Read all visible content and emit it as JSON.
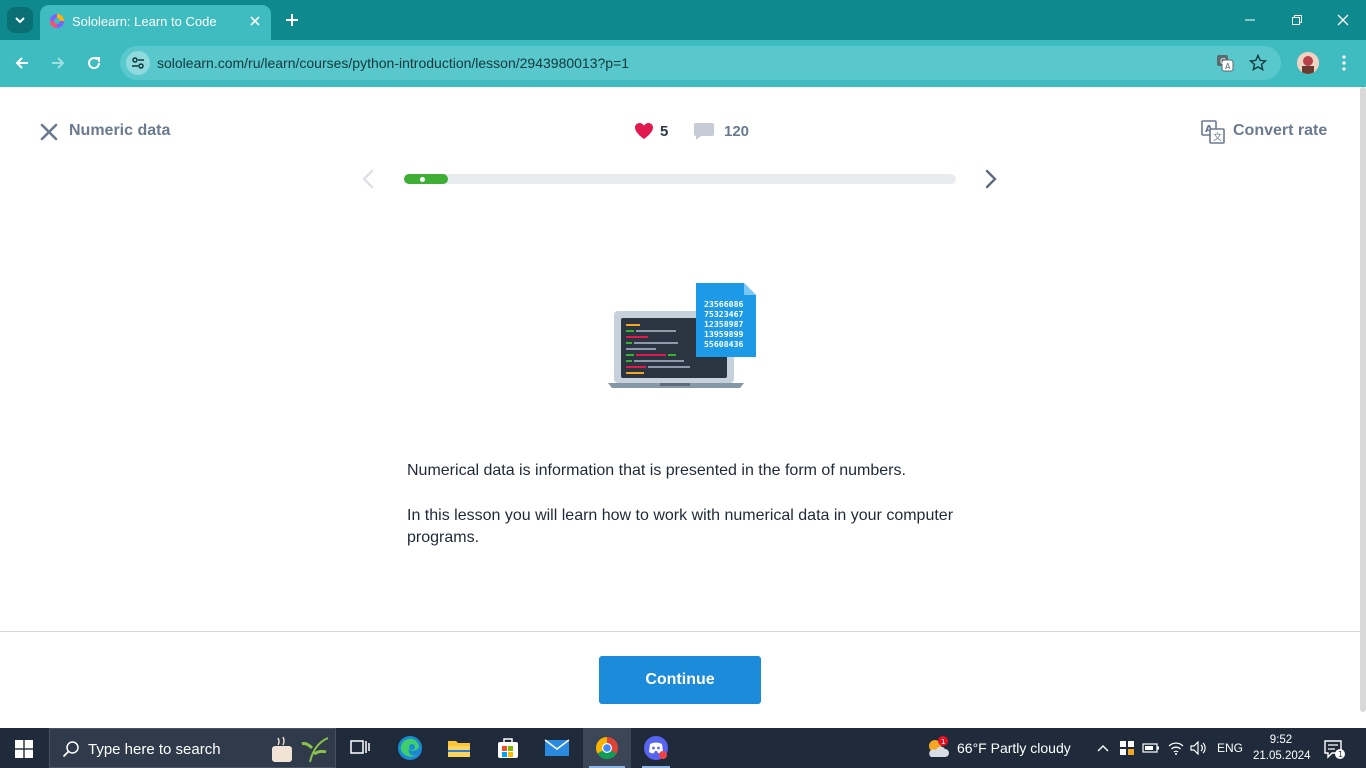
{
  "browser": {
    "tab_title": "Sololearn: Learn to Code",
    "url": "sololearn.com/ru/learn/courses/python-introduction/lesson/2943980013?p=1"
  },
  "lesson": {
    "title": "Numeric data",
    "lives": "5",
    "comments": "120",
    "convert_rate_label": "Convert rate",
    "progress_fraction": 0.08,
    "illustration_numbers": [
      "23566086",
      "75323467",
      "12358987",
      "13959899",
      "55608436"
    ],
    "paragraphs": [
      "Numerical data is information that is presented in the form of numbers.",
      "In this lesson you will learn how to work with numerical data in your computer programs."
    ],
    "continue_label": "Continue"
  },
  "taskbar": {
    "search_placeholder": "Type here to search",
    "weather": "66°F  Partly cloudy",
    "weather_badge": "1",
    "language": "ENG",
    "time": "9:52",
    "date": "21.05.2024",
    "notification_count": "1"
  },
  "colors": {
    "tabbar": "#0e8a8e",
    "toolbar": "#3ebcc0",
    "progress": "#3fae35",
    "heart": "#e0194f",
    "continue": "#1c8bd9"
  }
}
